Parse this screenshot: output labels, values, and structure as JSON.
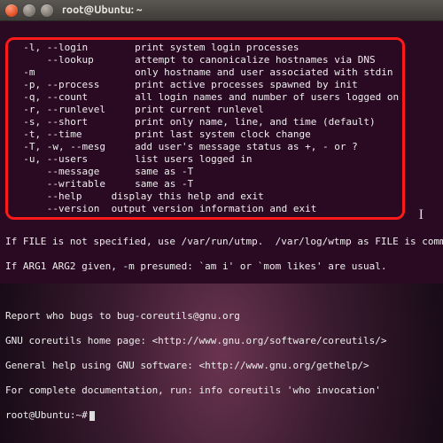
{
  "title": "root@Ubuntu: ~",
  "options": [
    {
      "flags": "-l, --login",
      "desc": "print system login processes"
    },
    {
      "flags": "    --lookup",
      "desc": "attempt to canonicalize hostnames via DNS"
    },
    {
      "flags": "-m",
      "desc": "only hostname and user associated with stdin"
    },
    {
      "flags": "-p, --process",
      "desc": "print active processes spawned by init"
    },
    {
      "flags": "-q, --count",
      "desc": "all login names and number of users logged on"
    },
    {
      "flags": "-r, --runlevel",
      "desc": "print current runlevel"
    },
    {
      "flags": "-s, --short",
      "desc": "print only name, line, and time (default)"
    },
    {
      "flags": "-t, --time",
      "desc": "print last system clock change"
    },
    {
      "flags": "-T, -w, --mesg",
      "desc": "add user's message status as +, - or ?"
    },
    {
      "flags": "-u, --users",
      "desc": "list users logged in"
    },
    {
      "flags": "    --message",
      "desc": "same as -T"
    },
    {
      "flags": "    --writable",
      "desc": "same as -T"
    },
    {
      "flags": "    --help",
      "desc": "display this help and exit",
      "tight": true
    },
    {
      "flags": "    --version",
      "desc": "output version information and exit",
      "tight": true
    }
  ],
  "footer": {
    "l1": "If FILE is not specified, use /var/run/utmp.  /var/log/wtmp as FILE is common.",
    "l2": "If ARG1 ARG2 given, -m presumed: `am i' or `mom likes' are usual.",
    "l3": "Report who bugs to bug-coreutils@gnu.org",
    "l4": "GNU coreutils home page: <http://www.gnu.org/software/coreutils/>",
    "l5": "General help using GNU software: <http://www.gnu.org/gethelp/>",
    "l6": "For complete documentation, run: info coreutils 'who invocation'"
  },
  "prompt": "root@Ubuntu:~#",
  "cursor_glyph": "I"
}
